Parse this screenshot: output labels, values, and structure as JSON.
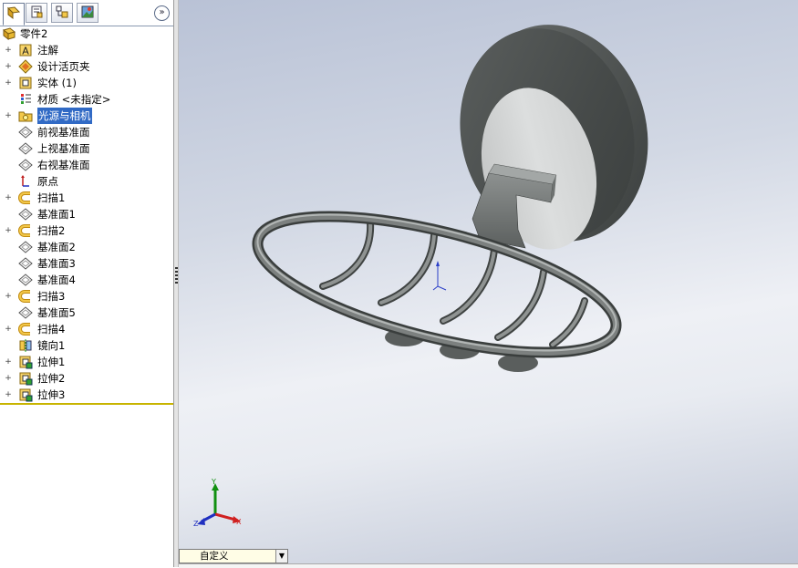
{
  "tabs": [
    {
      "name": "featuremanager-tab",
      "icon": "feature-tree-icon"
    },
    {
      "name": "propertymanager-tab",
      "icon": "property-sheet-icon"
    },
    {
      "name": "configurationmanager-tab",
      "icon": "configuration-icon"
    },
    {
      "name": "displaymanager-tab",
      "icon": "display-manager-icon"
    }
  ],
  "collapse_glyph": "»",
  "tree": {
    "root": "零件2",
    "items": [
      {
        "label": "注解",
        "icon": "annotation-icon",
        "expandable": true
      },
      {
        "label": "设计活页夹",
        "icon": "design-binder-icon",
        "expandable": true
      },
      {
        "label": "实体 (1)",
        "icon": "solid-bodies-icon",
        "expandable": true
      },
      {
        "label": "材质 <未指定>",
        "icon": "material-icon",
        "expandable": false
      },
      {
        "label": "光源与相机",
        "icon": "lights-cameras-icon",
        "expandable": true,
        "selected": true
      },
      {
        "label": "前视基准面",
        "icon": "plane-icon",
        "expandable": false
      },
      {
        "label": "上视基准面",
        "icon": "plane-icon",
        "expandable": false
      },
      {
        "label": "右视基准面",
        "icon": "plane-icon",
        "expandable": false
      },
      {
        "label": "原点",
        "icon": "origin-icon",
        "expandable": false
      },
      {
        "label": "扫描1",
        "icon": "sweep-icon",
        "expandable": true
      },
      {
        "label": "基准面1",
        "icon": "plane-icon",
        "expandable": false
      },
      {
        "label": "扫描2",
        "icon": "sweep-icon",
        "expandable": true
      },
      {
        "label": "基准面2",
        "icon": "plane-icon",
        "expandable": false
      },
      {
        "label": "基准面3",
        "icon": "plane-icon",
        "expandable": false
      },
      {
        "label": "基准面4",
        "icon": "plane-icon",
        "expandable": false
      },
      {
        "label": "扫描3",
        "icon": "sweep-icon",
        "expandable": true
      },
      {
        "label": "基准面5",
        "icon": "plane-icon",
        "expandable": false
      },
      {
        "label": "扫描4",
        "icon": "sweep-icon",
        "expandable": true
      },
      {
        "label": "镜向1",
        "icon": "mirror-icon",
        "expandable": false
      },
      {
        "label": "拉伸1",
        "icon": "extrude-icon",
        "expandable": true
      },
      {
        "label": "拉伸2",
        "icon": "extrude-icon",
        "expandable": true
      },
      {
        "label": "拉伸3",
        "icon": "extrude-icon",
        "expandable": true
      }
    ]
  },
  "viewport": {
    "model": "soap-dish-model",
    "triad": {
      "x": "X",
      "y": "Y",
      "z": "Z"
    },
    "view_orientation": "自定义"
  },
  "colors": {
    "selection": "#316ac5",
    "rollback_bar": "#c8b400",
    "triad_x": "#d02020",
    "triad_y": "#109010",
    "triad_z": "#2030c0"
  }
}
